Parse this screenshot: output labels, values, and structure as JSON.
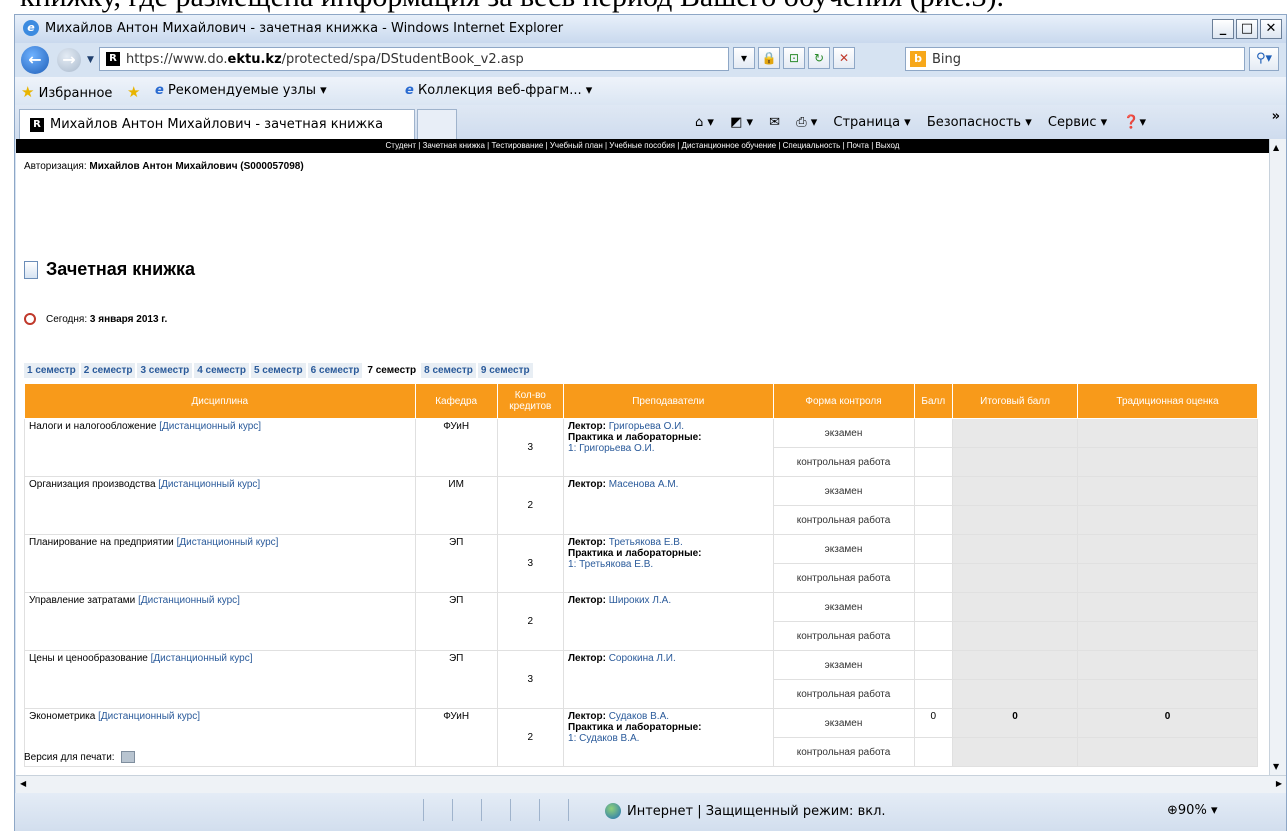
{
  "doc_top_text": "книжку, где размещена информация за весь период Вашего обучения (рис.3).",
  "browser": {
    "title": "Михайлов Антон Михайлович - зачетная книжка - Windows Internet Explorer",
    "url_prefix": "https://www.do.",
    "url_bold": "ektu.kz",
    "url_suffix": "/protected/spa/DStudentBook_v2.asp",
    "search_text": "Bing",
    "favorites_label": "Избранное",
    "fav_sites_label": "Рекомендуемые узлы ▾",
    "fav_gallery_label": "Коллекция веб-фрагм... ▾",
    "tab_title": "Михайлов Антон Михайлович - зачетная книжка",
    "cmd_page": "Страница ▾",
    "cmd_security": "Безопасность ▾",
    "cmd_service": "Сервис ▾",
    "status_zone": "Интернет | Защищенный режим: вкл.",
    "zoom": "90%"
  },
  "page": {
    "topnav": "Студент | Зачетная книжка | Тестирование | Учебный план | Учебные пособия | Дистанционное обучение | Специальность | Почта | Выход",
    "auth_label": "Авторизация:",
    "auth_user": "Михайлов Антон Михайлович (S000057098)",
    "title": "Зачетная книжка",
    "today_label": "Сегодня:",
    "today_value": "3 января 2013 г.",
    "semesters": [
      "1 семестр",
      "2 семестр",
      "3 семестр",
      "4 семестр",
      "5 семестр",
      "6 семестр",
      "7 семестр",
      "8 семестр",
      "9 семестр"
    ],
    "active_semester": 6,
    "columns": [
      "Дисциплина",
      "Кафедра",
      "Кол-во кредитов",
      "Преподаватели",
      "Форма контроля",
      "Балл",
      "Итоговый балл",
      "Традиционная оценка"
    ],
    "lecturer_label": "Лектор:",
    "practice_label": "Практика и лабораторные:",
    "course_link": "[Дистанционный курс]",
    "form_exam": "экзамен",
    "form_test": "контрольная работа",
    "rows": [
      {
        "name": "Налоги и налогообложение",
        "dept": "ФУиН",
        "credits": "3",
        "lecturer": "Григорьева О.И.",
        "practice": "1: Григорьева О.И.",
        "score": "",
        "total": "",
        "grade": ""
      },
      {
        "name": "Организация производства",
        "dept": "ИМ",
        "credits": "2",
        "lecturer": "Масенова А.М.",
        "practice": "",
        "score": "",
        "total": "",
        "grade": ""
      },
      {
        "name": "Планирование на предприятии",
        "dept": "ЭП",
        "credits": "3",
        "lecturer": "Третьякова Е.В.",
        "practice": "1: Третьякова Е.В.",
        "score": "",
        "total": "",
        "grade": ""
      },
      {
        "name": "Управление затратами",
        "dept": "ЭП",
        "credits": "2",
        "lecturer": "Широких Л.А.",
        "practice": "",
        "score": "",
        "total": "",
        "grade": ""
      },
      {
        "name": "Цены и ценообразование",
        "dept": "ЭП",
        "credits": "3",
        "lecturer": "Сорокина Л.И.",
        "practice": "",
        "score": "",
        "total": "",
        "grade": ""
      },
      {
        "name": "Эконометрика",
        "dept": "ФУиН",
        "credits": "2",
        "lecturer": "Судаков В.А.",
        "practice": "1: Судаков В.А.",
        "score": "0",
        "total": "0",
        "grade": "0"
      }
    ],
    "print_label": "Версия для печати:"
  }
}
